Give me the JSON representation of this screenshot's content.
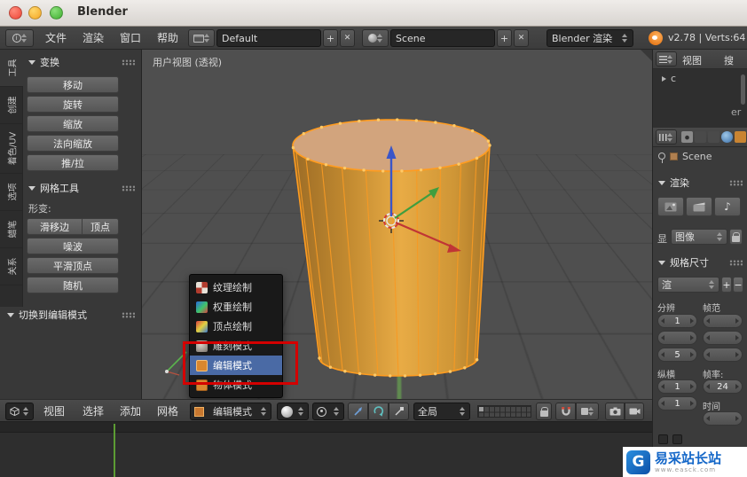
{
  "window": {
    "title": "Blender",
    "stats": "v2.78 | Verts:64"
  },
  "colors": {
    "selection_highlight": "#4a6aa5",
    "edit_orange": "#ff9e2c",
    "annotation_red": "#d40000",
    "axis_x_red": "#c03535",
    "axis_y_green": "#4ea84e",
    "axis_z_blue": "#3a55c8",
    "watermark_blue": "#1467c8"
  },
  "infobar": {
    "menus": [
      "文件",
      "渲染",
      "窗口",
      "帮助"
    ],
    "layout_name": "Default",
    "scene_name": "Scene",
    "engine_name": "Blender 渲染",
    "add_label": "+",
    "close_label": "✕"
  },
  "toolshelf": {
    "tabs": [
      "工具",
      "创建",
      "着色/UV",
      "选项",
      "蜡笔",
      "关系"
    ],
    "transform": {
      "title": "变换",
      "buttons": [
        "移动",
        "旋转",
        "缩放",
        "法向缩放",
        "推/拉"
      ]
    },
    "mesh_tools": {
      "title": "网格工具",
      "deform_label": "形变:",
      "pair_buttons": [
        "滑移边",
        "顶点"
      ],
      "buttons": [
        "噪波",
        "平滑顶点",
        "随机"
      ]
    },
    "operator_title": "切换到编辑模式"
  },
  "viewport": {
    "view_label": "用户视图 (透视)"
  },
  "mode_menu": {
    "items": [
      "纹理绘制",
      "权重绘制",
      "顶点绘制",
      "雕刻模式",
      "编辑模式",
      "物体模式"
    ],
    "selected_item": "编辑模式"
  },
  "view_header": {
    "menus": [
      "视图",
      "选择",
      "添加",
      "网格"
    ],
    "mode": "编辑模式",
    "orientation": "全局"
  },
  "outliner": {
    "view_menu": "视图",
    "search_label": "搜",
    "item_a": "c",
    "item_b": "er"
  },
  "properties": {
    "breadcrumb": "Scene",
    "render": {
      "title": "渲染",
      "display_label": "显",
      "display_value": "图像"
    },
    "dimensions": {
      "title": "规格尺寸",
      "preset": "渲",
      "add_label": "+",
      "remove_label": "−",
      "resolution_label": "分辨",
      "frame_range_label": "帧范",
      "res_x": "1",
      "res_percent": "5",
      "aspect_label": "纵横",
      "aspect_x": "1",
      "aspect_y": "1",
      "framerate_label": "帧率:",
      "fps": "24",
      "time_label": "时间"
    }
  },
  "watermark": {
    "title": "易采站长站",
    "subtitle": "www.easck.com"
  }
}
